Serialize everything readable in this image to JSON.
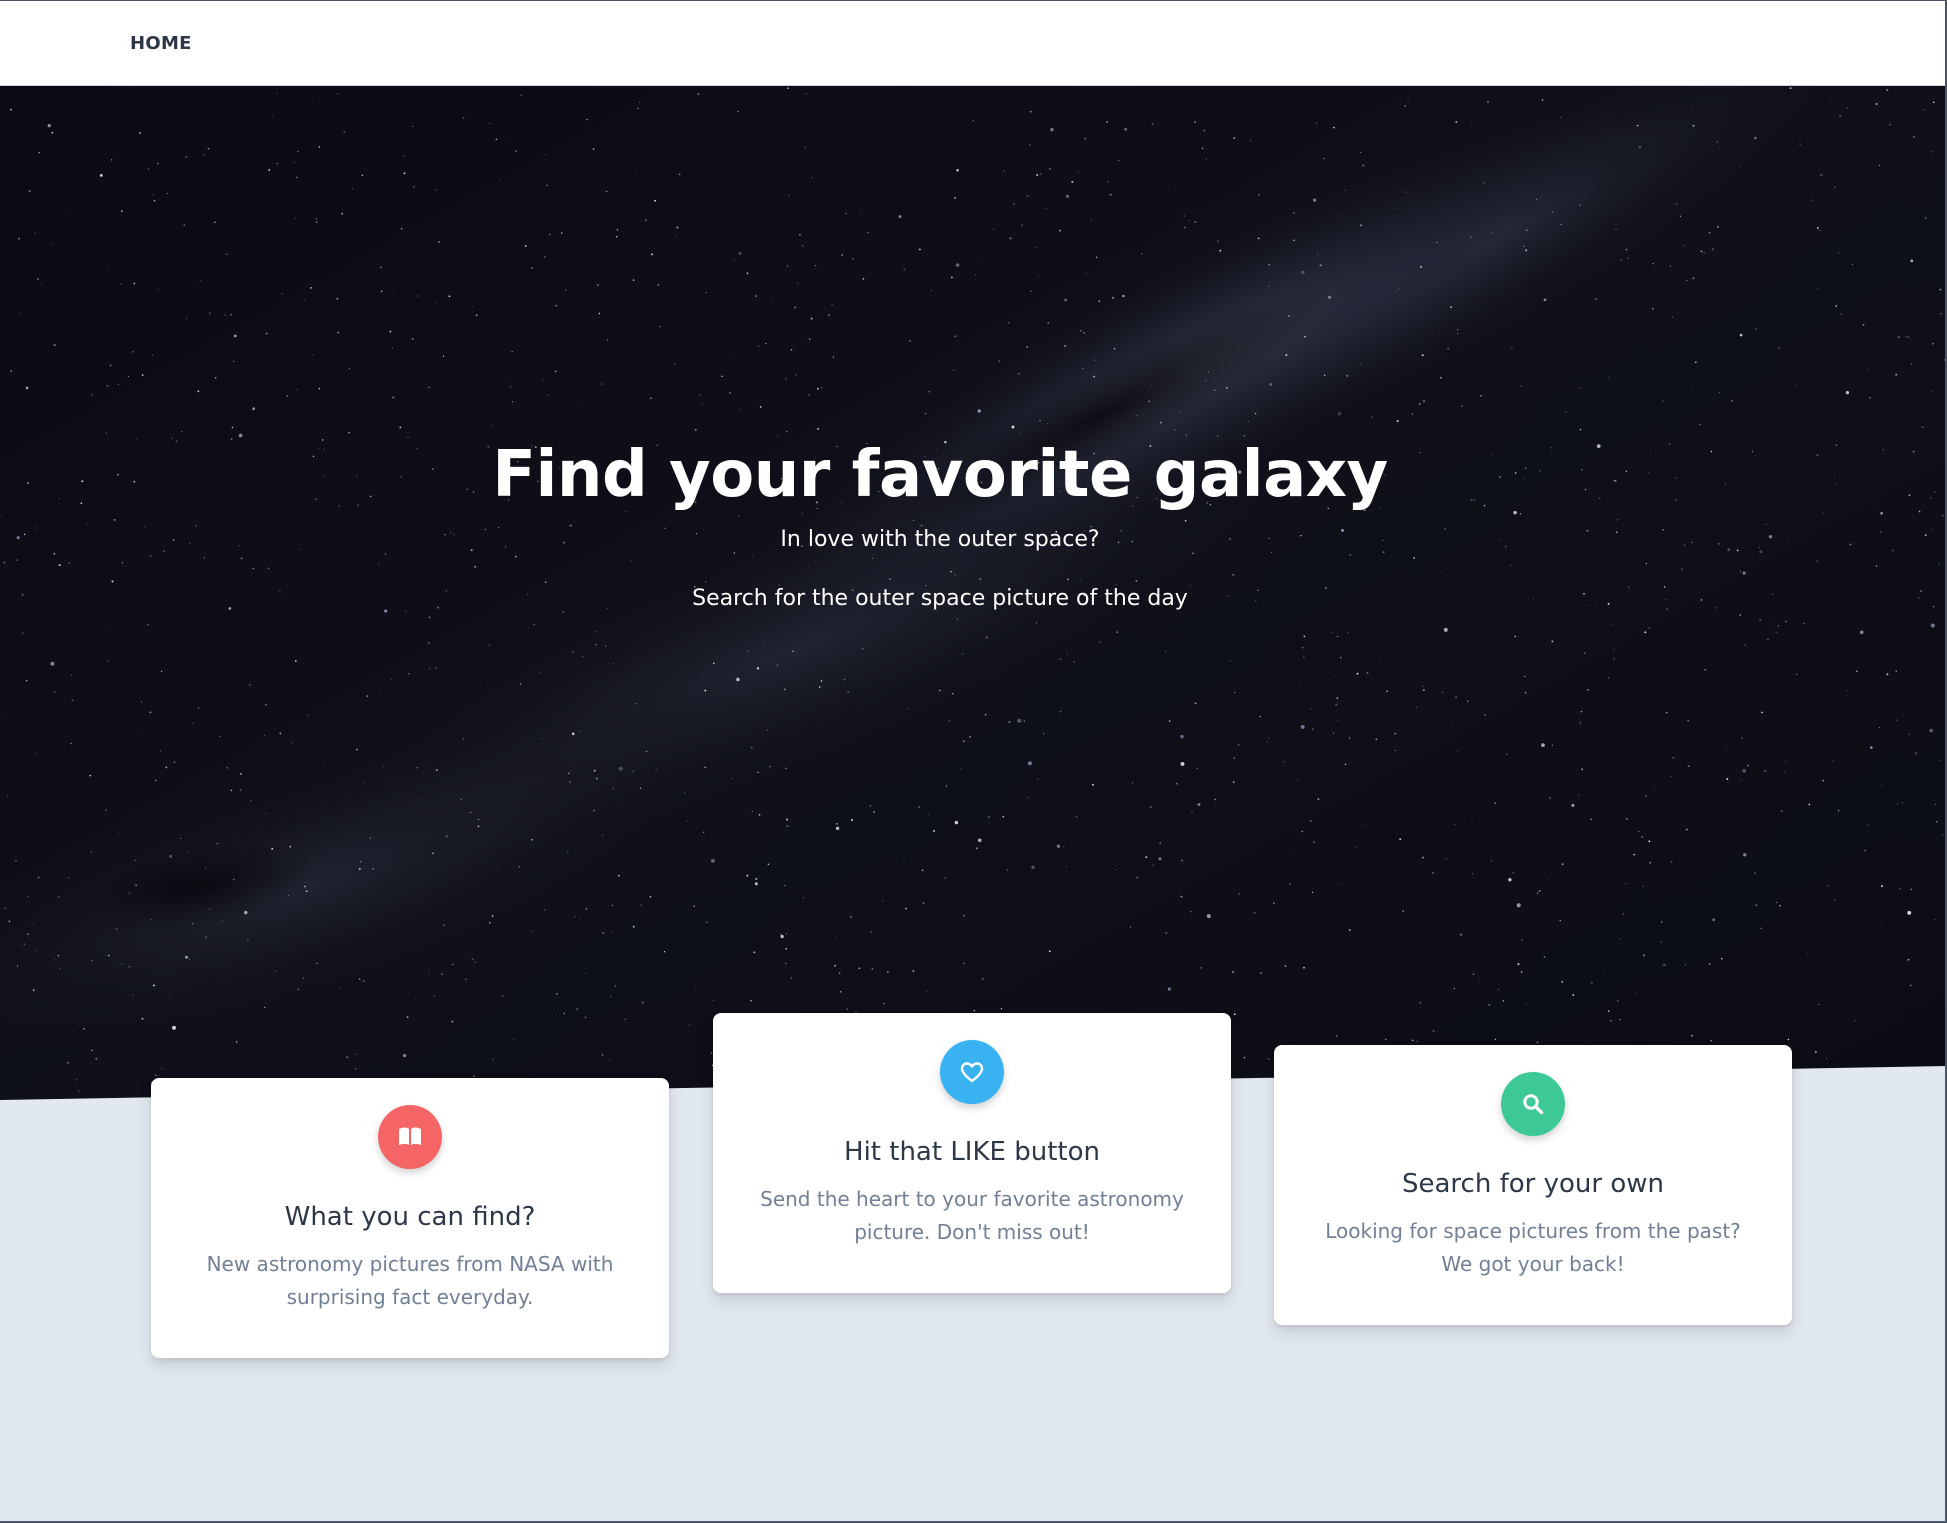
{
  "nav": {
    "home_label": "HOME"
  },
  "hero": {
    "title": "Find your favorite galaxy",
    "subtitle_1": "In love with the outer space?",
    "subtitle_2": "Search for the outer space picture of the day"
  },
  "cards": [
    {
      "title": "What you can find?",
      "text": "New astronomy pictures from NASA with surprising fact everyday.",
      "icon": "book-open-icon",
      "icon_color": "#f56565"
    },
    {
      "title": "Hit that LIKE button",
      "text": "Send the heart to your favorite astronomy picture. Don't miss out!",
      "icon": "heart-icon",
      "icon_color": "#38b2f0"
    },
    {
      "title": "Search for your own",
      "text": "Looking for space pictures from the past? We got your back!",
      "icon": "search-icon",
      "icon_color": "#3cc996"
    }
  ],
  "colors": {
    "page_background": "#e2e8f0",
    "hero_background": "#0d0d17",
    "heading_text": "#2d3748",
    "body_text": "#718096"
  }
}
